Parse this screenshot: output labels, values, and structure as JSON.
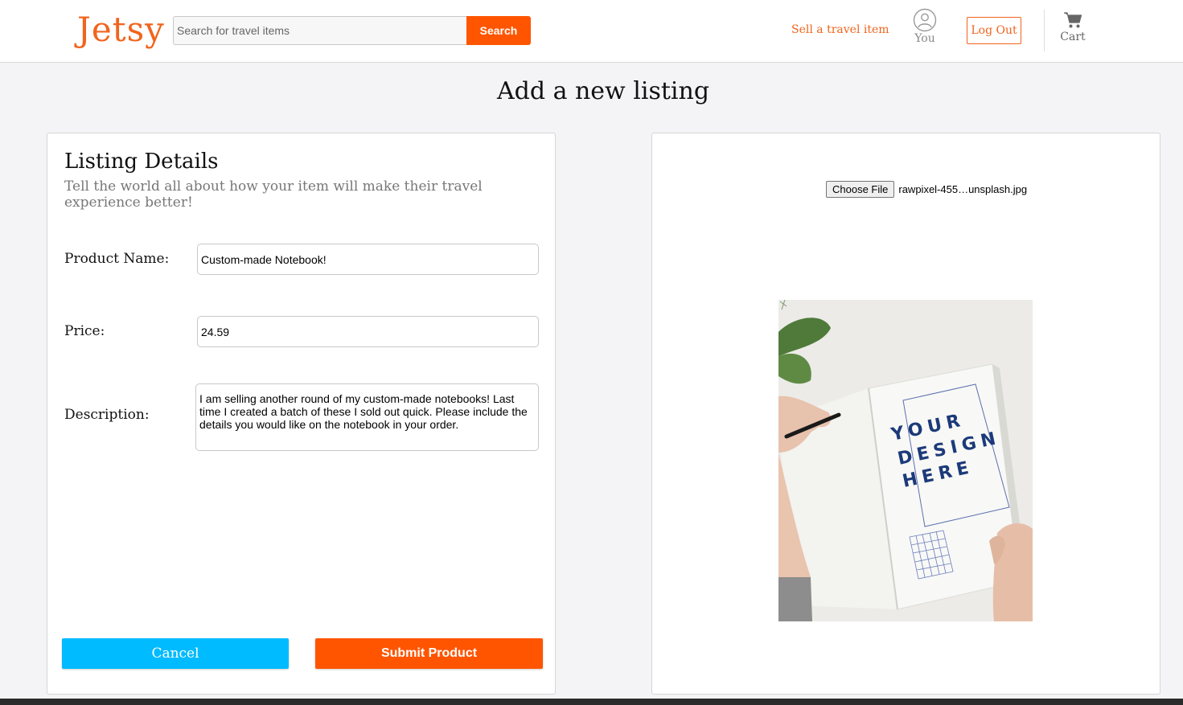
{
  "header": {
    "logo": "Jetsy",
    "search_placeholder": "Search for travel items",
    "search_button": "Search",
    "sell_link": "Sell a travel item",
    "you_label": "You",
    "logout_button": "Log Out",
    "cart_label": "Cart"
  },
  "page": {
    "title": "Add a new listing"
  },
  "listing": {
    "title": "Listing Details",
    "subtitle": "Tell the world all about how your item will make their travel experience better!",
    "product_name_label": "Product Name:",
    "product_name_value": "Custom-made Notebook!",
    "price_label": "Price:",
    "price_value": "24.59",
    "description_label": "Description:",
    "description_value": "I am selling another round of my custom-made notebooks! Last time I created a batch of these I sold out quick. Please include the details you would like on the notebook in your order.",
    "cancel_button": "Cancel",
    "submit_button": "Submit Product"
  },
  "upload": {
    "choose_file_button": "Choose File",
    "file_name": "rawpixel-455…unsplash.jpg",
    "preview_text_lines": [
      "YOUR",
      "DESIGN",
      "HERE"
    ]
  },
  "colors": {
    "brand": "#f1641e",
    "submit": "#ff5500",
    "cancel": "#00bbff",
    "preview_text": "#1c3a7a"
  },
  "icons": {
    "you": "user-circle-icon",
    "cart": "cart-icon"
  }
}
